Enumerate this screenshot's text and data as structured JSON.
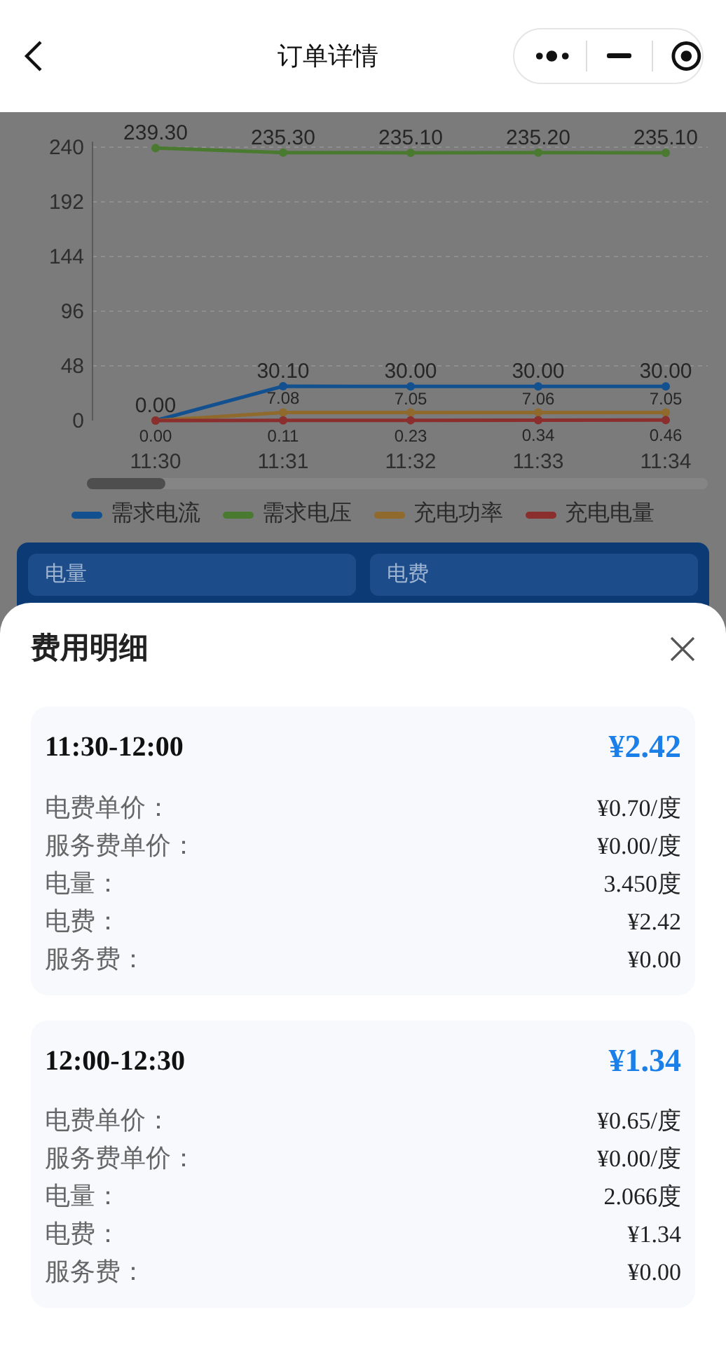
{
  "header": {
    "title": "订单详情"
  },
  "chart": {
    "chart_data": {
      "type": "line",
      "categories": [
        "11:30",
        "11:31",
        "11:32",
        "11:33",
        "11:34"
      ],
      "ylim": [
        0,
        240
      ],
      "yticks": [
        0,
        48,
        96,
        144,
        192,
        240
      ],
      "grid": true,
      "legend": "bottom",
      "series": [
        {
          "name": "需求电流",
          "color": "#12508f",
          "marker": "circle",
          "values": [
            0,
            30.1,
            30,
            30,
            30
          ],
          "value_labels": [
            "0.00",
            "30.10",
            "30.00",
            "30.00",
            "30.00"
          ]
        },
        {
          "name": "需求电压",
          "color": "#4a7a30",
          "marker": "circle",
          "values": [
            239.3,
            235.3,
            235.1,
            235.2,
            235.1
          ],
          "value_labels": [
            "239.30",
            "235.30",
            "235.10",
            "235.20",
            "235.10"
          ]
        },
        {
          "name": "充电功率",
          "color": "#8f6a2c",
          "marker": "circle",
          "values": [
            0,
            7.08,
            7.05,
            7.06,
            7.05
          ],
          "value_labels": [
            null,
            "7.08",
            "7.05",
            "7.06",
            "7.05"
          ]
        },
        {
          "name": "充电电量",
          "color": "#8a2e2e",
          "marker": "circle",
          "values": [
            0,
            0.11,
            0.23,
            0.34,
            0.46
          ],
          "value_labels": [
            "0.00",
            "0.11",
            "0.23",
            "0.34",
            "0.46"
          ]
        }
      ]
    }
  },
  "summary_card": {
    "fields": [
      {
        "label": "电量"
      },
      {
        "label": "电费"
      }
    ]
  },
  "sheet": {
    "title": "费用明细",
    "periods": [
      {
        "time": "11:30-12:00",
        "total": "¥2.42",
        "rows": [
          {
            "label": "电费单价：",
            "value": "¥0.70/度"
          },
          {
            "label": "服务费单价：",
            "value": "¥0.00/度"
          },
          {
            "label": "电量：",
            "value": "3.450度"
          },
          {
            "label": "电费：",
            "value": "¥2.42"
          },
          {
            "label": "服务费：",
            "value": "¥0.00"
          }
        ]
      },
      {
        "time": "12:00-12:30",
        "total": "¥1.34",
        "rows": [
          {
            "label": "电费单价：",
            "value": "¥0.65/度"
          },
          {
            "label": "服务费单价：",
            "value": "¥0.00/度"
          },
          {
            "label": "电量：",
            "value": "2.066度"
          },
          {
            "label": "电费：",
            "value": "¥1.34"
          },
          {
            "label": "服务费：",
            "value": "¥0.00"
          }
        ]
      }
    ]
  }
}
